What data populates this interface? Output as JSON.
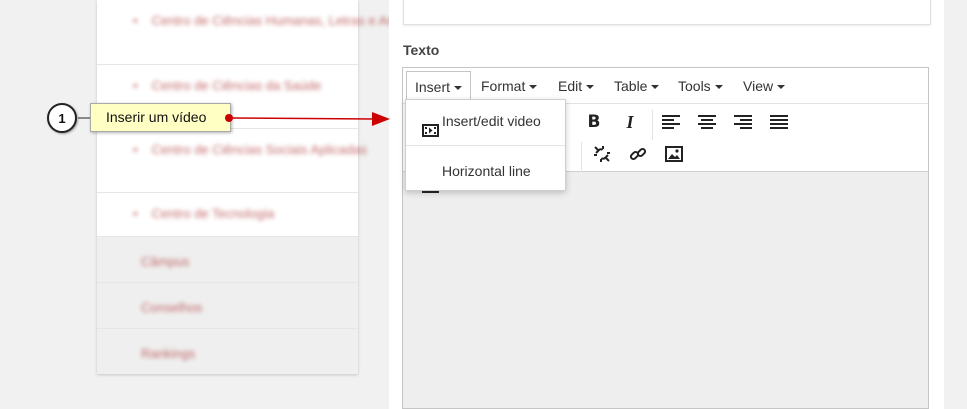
{
  "sidebar": {
    "items": [
      {
        "label": "Centro de Ciências Humanas, Letras e Artes",
        "bullet": true
      },
      {
        "label": "Centro de Ciências da Saúde",
        "bullet": true
      },
      {
        "label": "Centro de Ciências Sociais Aplicadas",
        "bullet": true
      },
      {
        "label": "Centro de Tecnologia",
        "bullet": true
      },
      {
        "label": "Câmpus",
        "bullet": false
      },
      {
        "label": "Conselhos",
        "bullet": false
      },
      {
        "label": "Rankings",
        "bullet": false
      }
    ]
  },
  "field_label": "Texto",
  "menubar": [
    "Insert",
    "Format",
    "Edit",
    "Table",
    "Tools",
    "View"
  ],
  "active_menu": "Insert",
  "insert_menu": {
    "items": [
      {
        "label": "Insert/edit video",
        "icon": "video-icon"
      },
      {
        "label": "Horizontal line",
        "icon": "horizontal-line-icon"
      }
    ]
  },
  "toolbar": {
    "bold_label": "B",
    "italic_label": "I",
    "buttons": [
      "bold",
      "italic",
      "align-left",
      "align-center",
      "align-right",
      "align-justify",
      "numbered-list",
      "unlink",
      "link",
      "image"
    ]
  },
  "callout": {
    "step": "1",
    "text": "Inserir um vídeo",
    "color": "#ffffc4",
    "arrow_color": "#cc0000"
  }
}
